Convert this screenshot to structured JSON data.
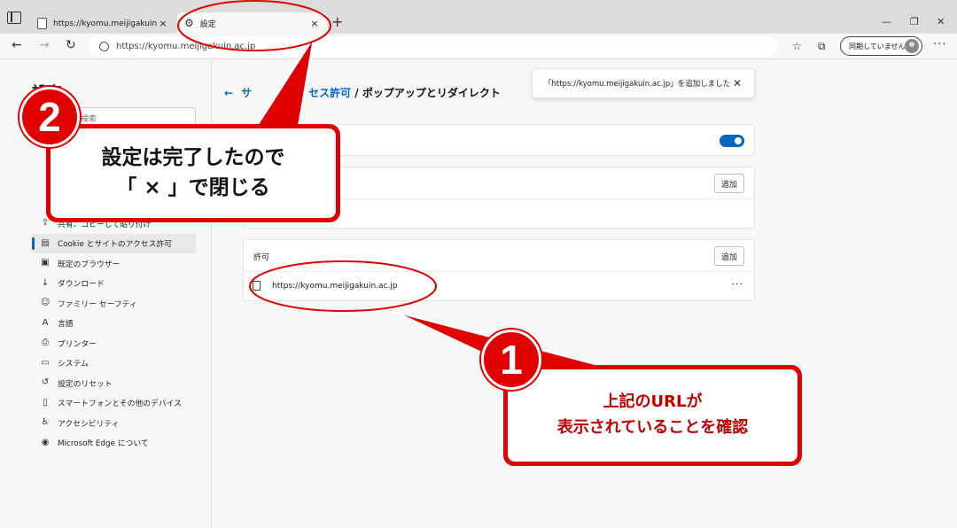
{
  "tabs": [
    {
      "title": "https://kyomu.meijigakuin.ac.jp",
      "close": "×"
    },
    {
      "title": "設定",
      "close": "×"
    }
  ],
  "new_tab": "+",
  "window_controls": {
    "minimize": "—",
    "maximize": "❐",
    "close": "✕"
  },
  "address": {
    "url": "https://kyomu.meijigakuin.ac.jp"
  },
  "profile": {
    "sync_label": "同期していません"
  },
  "sidebar": {
    "title": "設定",
    "search_placeholder": "検索",
    "items": [
      {
        "label": "共有、コピーして貼り付け",
        "icon": "share-icon",
        "glyph": "⇪"
      },
      {
        "label": "Cookie とサイトのアクセス許可",
        "icon": "cookie-icon",
        "glyph": "▤",
        "active": true
      },
      {
        "label": "既定のブラウザー",
        "icon": "browser-icon",
        "glyph": "▣"
      },
      {
        "label": "ダウンロード",
        "icon": "download-icon",
        "glyph": "↓"
      },
      {
        "label": "ファミリー セーフティ",
        "icon": "family-icon",
        "glyph": "☺"
      },
      {
        "label": "言語",
        "icon": "language-icon",
        "glyph": "A"
      },
      {
        "label": "プリンター",
        "icon": "printer-icon",
        "glyph": "⎙"
      },
      {
        "label": "システム",
        "icon": "system-icon",
        "glyph": "▭"
      },
      {
        "label": "設定のリセット",
        "icon": "reset-icon",
        "glyph": "↺"
      },
      {
        "label": "スマートフォンとその他のデバイス",
        "icon": "phone-icon",
        "glyph": "▯"
      },
      {
        "label": "アクセシビリティ",
        "icon": "accessibility-icon",
        "glyph": "♿"
      },
      {
        "label": "Microsoft Edge について",
        "icon": "edge-icon",
        "glyph": "◉"
      }
    ]
  },
  "breadcrumb": {
    "back": "←",
    "parent_visible": "サ",
    "parent_tail": "セス許可",
    "current": " / ポップアップとリダイレクト"
  },
  "toast": {
    "message": "「https://kyomu.meijigakuin.ac.jp」を追加しました",
    "close": "✕"
  },
  "block_section": {
    "add_label": "追加"
  },
  "allow_section": {
    "title": "許可",
    "add_label": "追加",
    "sites": [
      "https://kyomu.meijigakuin.ac.jp"
    ],
    "more": "···"
  },
  "annotations": {
    "step2": {
      "number": "2",
      "line1": "設定は完了したので",
      "line2": "「 × 」で閉じる"
    },
    "step1": {
      "number": "1",
      "line1": "上記のURLが",
      "line2": "表示されていることを確認"
    }
  },
  "colors": {
    "accent": "#0067c0",
    "annotation_red": "#e00000"
  }
}
